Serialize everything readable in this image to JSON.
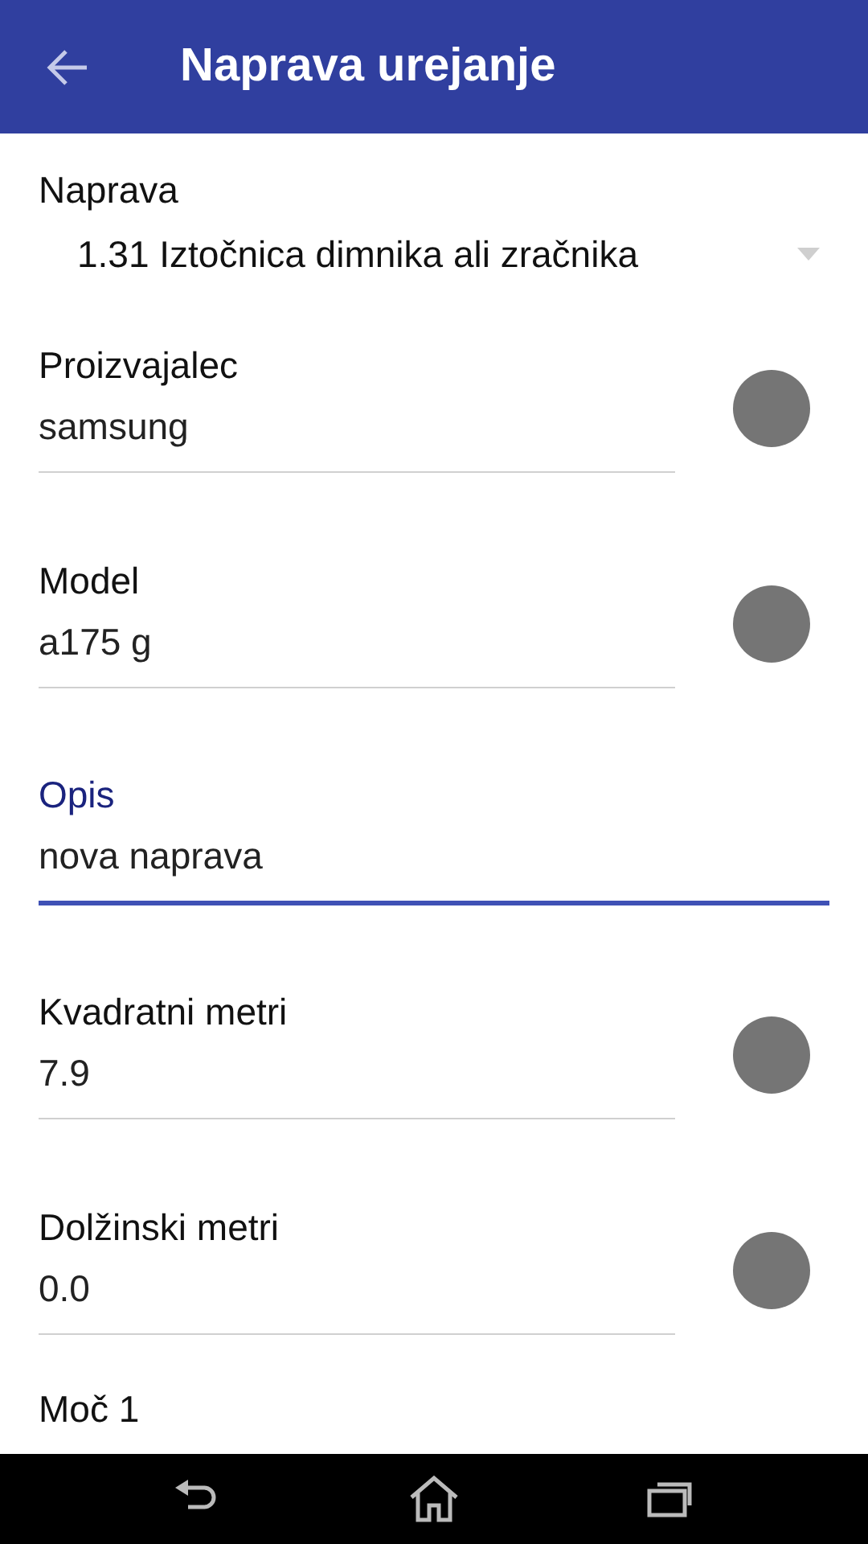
{
  "app_bar": {
    "title": "Naprava urejanje"
  },
  "device_select": {
    "label": "Naprava",
    "value": "1.31 Iztočnica dimnika ali zračnika"
  },
  "fields": [
    {
      "kind": "with-button",
      "label": "Proizvajalec",
      "value": "samsung",
      "focused": false
    },
    {
      "kind": "with-button",
      "label": "Model",
      "value": "a175 g",
      "focused": false
    },
    {
      "kind": "plain",
      "label": "Opis",
      "value": "nova naprava",
      "focused": true
    },
    {
      "kind": "with-button",
      "label": "Kvadratni metri",
      "value": "7.9",
      "focused": false
    },
    {
      "kind": "with-button",
      "label": "Dolžinski metri",
      "value": "0.0",
      "focused": false
    }
  ],
  "next_label": "Moč 1"
}
